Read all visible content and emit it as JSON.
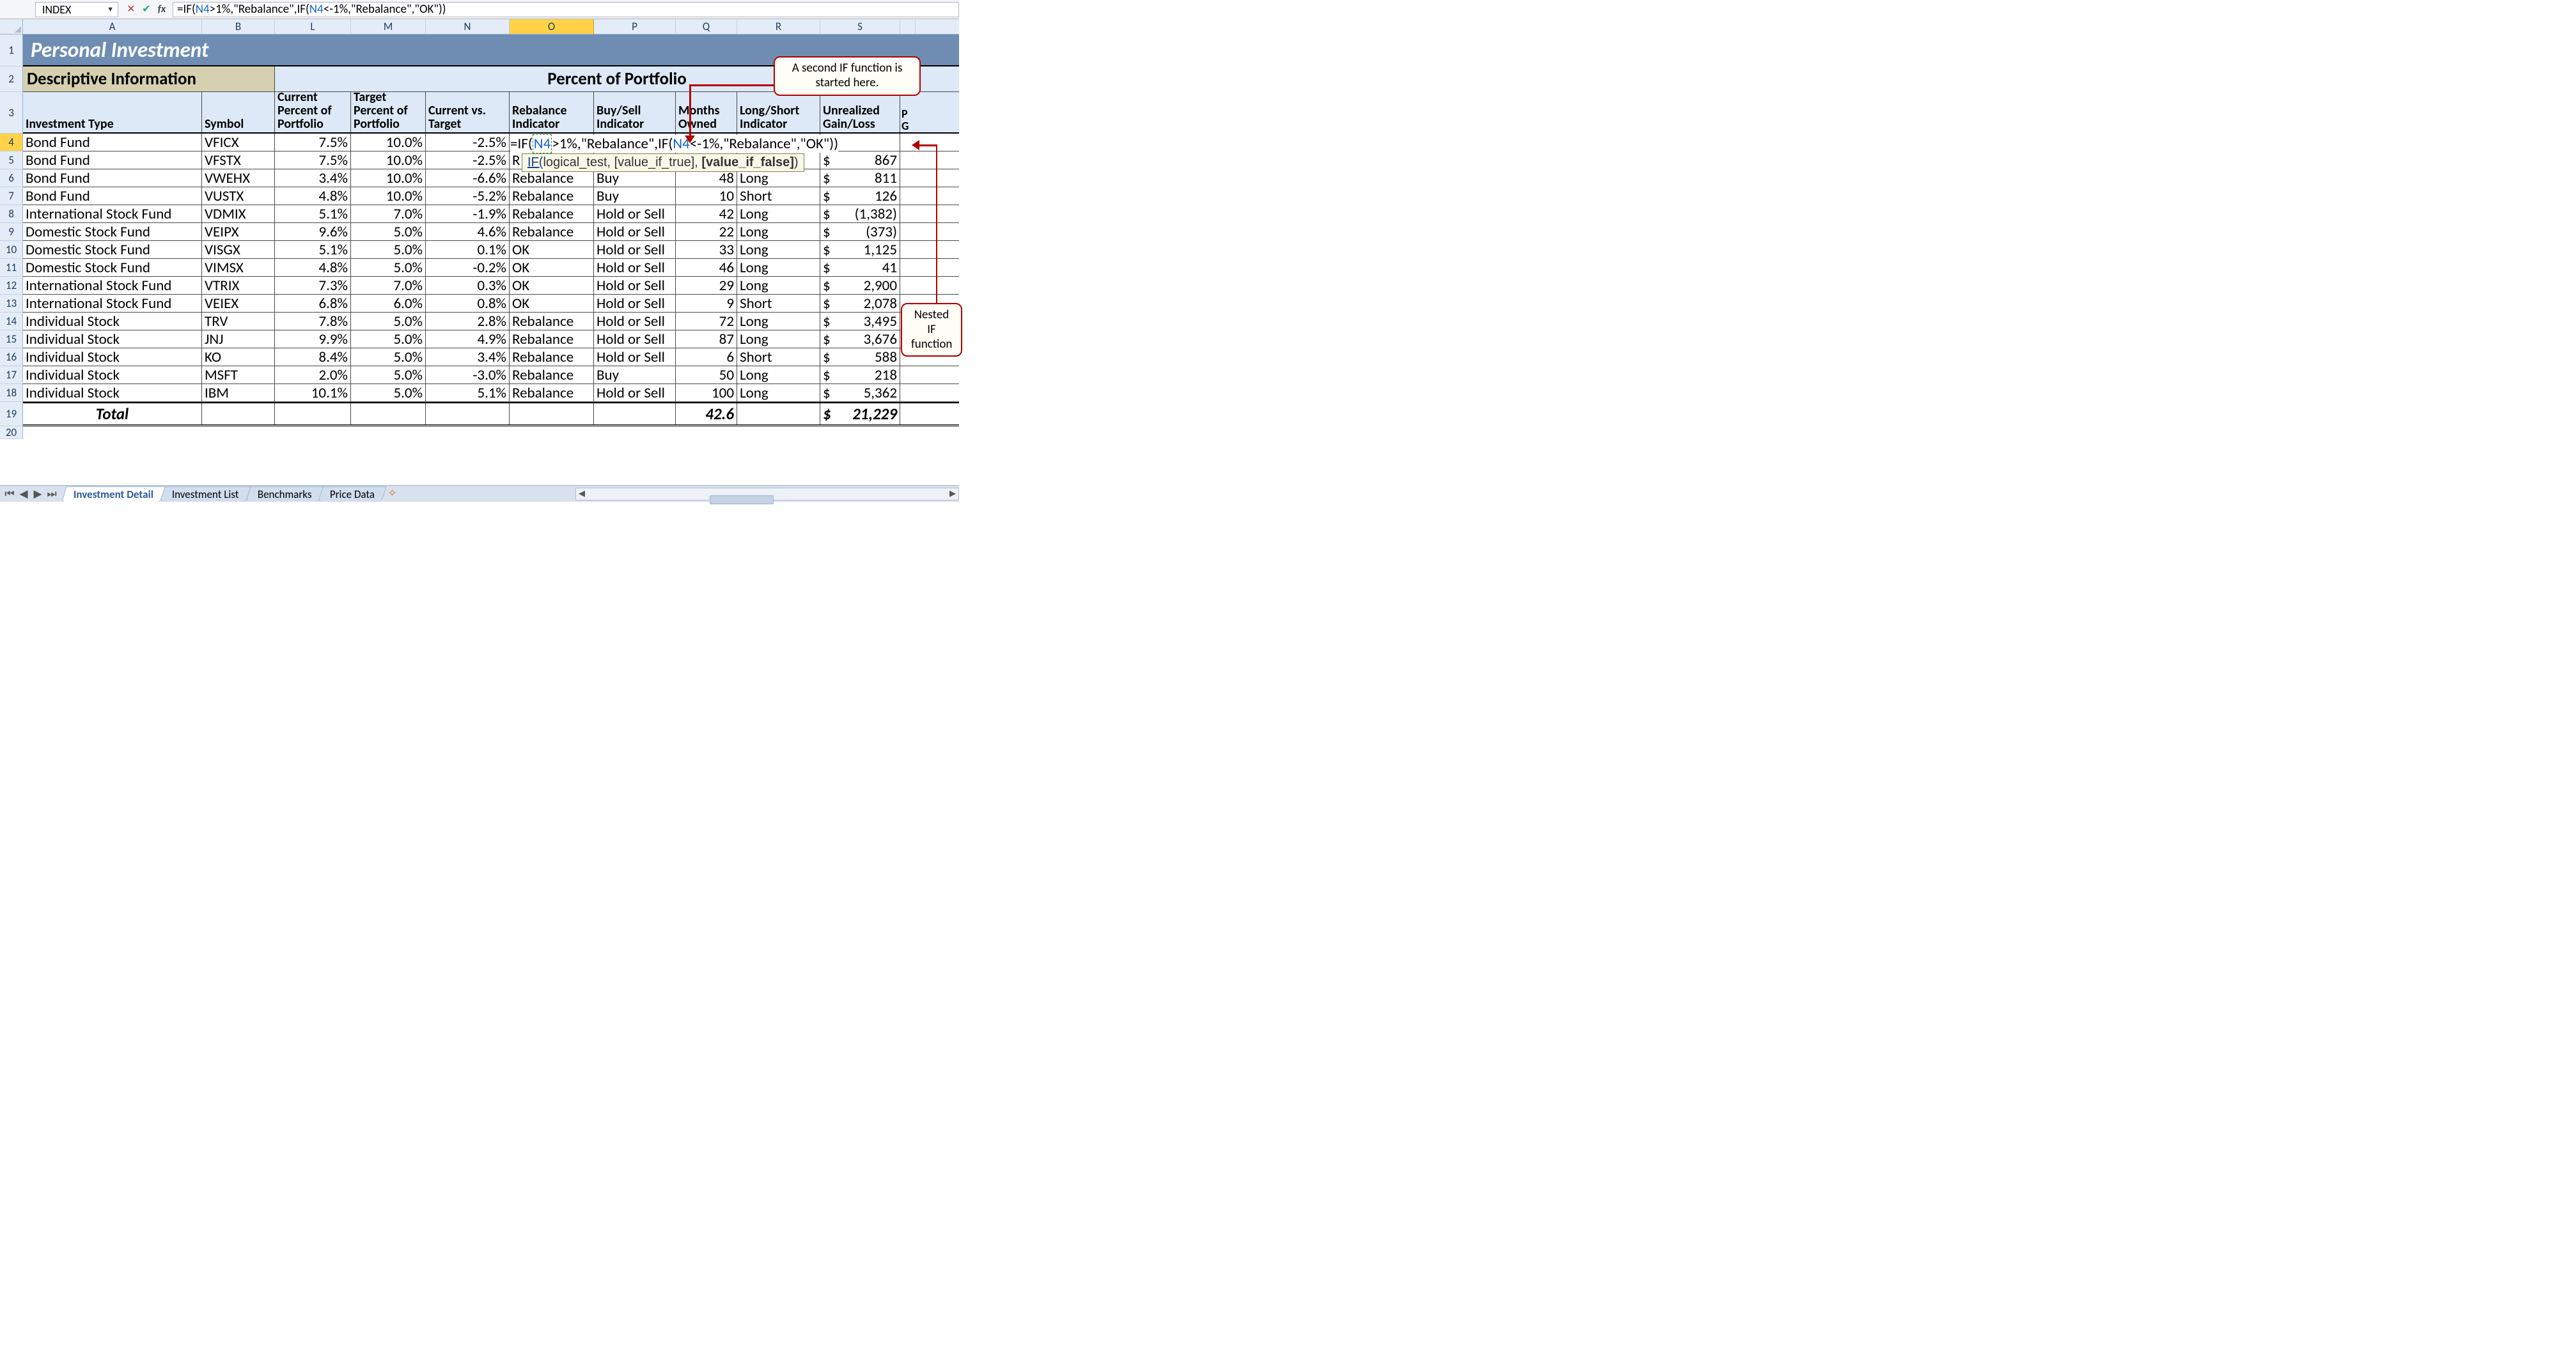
{
  "namebox": "INDEX",
  "formula_bar": "=IF(N4>1%,\"Rebalance\",IF(N4<-1%,\"Rebalance\",\"OK\"))",
  "title": "Personal Investment",
  "section_descriptive": "Descriptive Information",
  "section_pop": "Percent of Portfolio",
  "col_headers": {
    "A": "A",
    "B": "B",
    "L": "L",
    "M": "M",
    "N": "N",
    "O": "O",
    "P": "P",
    "Q": "Q",
    "R": "R",
    "S": "S"
  },
  "col_titles": {
    "A": "Investment Type",
    "B": "Symbol",
    "L": "Current Percent of Portfolio",
    "M": "Target Percent of Portfolio",
    "N": "Current vs. Target",
    "O": "Rebalance Indicator",
    "P": "Buy/Sell Indicator",
    "Q": "Months Owned",
    "R": "Long/Short Indicator",
    "S": "Unrealized Gain/Loss",
    "T": "Pe G"
  },
  "row_headers": [
    "1",
    "2",
    "3",
    "4",
    "5",
    "6",
    "7",
    "8",
    "9",
    "10",
    "11",
    "12",
    "13",
    "14",
    "15",
    "16",
    "17",
    "18",
    "19",
    "20"
  ],
  "data": [
    {
      "type": "Bond Fund",
      "sym": "VFICX",
      "cur": "7.5%",
      "tgt": "10.0%",
      "cvt": "-2.5%",
      "reb": "",
      "bs": "",
      "mo": "",
      "ls": "",
      "gain": ""
    },
    {
      "type": "Bond Fund",
      "sym": "VFSTX",
      "cur": "7.5%",
      "tgt": "10.0%",
      "cvt": "-2.5%",
      "reb": "R",
      "bs": "",
      "mo": "",
      "ls": "",
      "gain": "867"
    },
    {
      "type": "Bond Fund",
      "sym": "VWEHX",
      "cur": "3.4%",
      "tgt": "10.0%",
      "cvt": "-6.6%",
      "reb": "Rebalance",
      "bs": "Buy",
      "mo": "48",
      "ls": "Long",
      "gain": "811"
    },
    {
      "type": "Bond Fund",
      "sym": "VUSTX",
      "cur": "4.8%",
      "tgt": "10.0%",
      "cvt": "-5.2%",
      "reb": "Rebalance",
      "bs": "Buy",
      "mo": "10",
      "ls": "Short",
      "gain": "126"
    },
    {
      "type": "International Stock Fund",
      "sym": "VDMIX",
      "cur": "5.1%",
      "tgt": "7.0%",
      "cvt": "-1.9%",
      "reb": "Rebalance",
      "bs": "Hold or Sell",
      "mo": "42",
      "ls": "Long",
      "gain": "(1,382)"
    },
    {
      "type": "Domestic Stock Fund",
      "sym": "VEIPX",
      "cur": "9.6%",
      "tgt": "5.0%",
      "cvt": "4.6%",
      "reb": "Rebalance",
      "bs": "Hold or Sell",
      "mo": "22",
      "ls": "Long",
      "gain": "(373)"
    },
    {
      "type": "Domestic Stock Fund",
      "sym": "VISGX",
      "cur": "5.1%",
      "tgt": "5.0%",
      "cvt": "0.1%",
      "reb": "OK",
      "bs": "Hold or Sell",
      "mo": "33",
      "ls": "Long",
      "gain": "1,125"
    },
    {
      "type": "Domestic Stock Fund",
      "sym": "VIMSX",
      "cur": "4.8%",
      "tgt": "5.0%",
      "cvt": "-0.2%",
      "reb": "OK",
      "bs": "Hold or Sell",
      "mo": "46",
      "ls": "Long",
      "gain": "41"
    },
    {
      "type": "International Stock Fund",
      "sym": "VTRIX",
      "cur": "7.3%",
      "tgt": "7.0%",
      "cvt": "0.3%",
      "reb": "OK",
      "bs": "Hold or Sell",
      "mo": "29",
      "ls": "Long",
      "gain": "2,900"
    },
    {
      "type": "International Stock Fund",
      "sym": "VEIEX",
      "cur": "6.8%",
      "tgt": "6.0%",
      "cvt": "0.8%",
      "reb": "OK",
      "bs": "Hold or Sell",
      "mo": "9",
      "ls": "Short",
      "gain": "2,078"
    },
    {
      "type": "Individual Stock",
      "sym": "TRV",
      "cur": "7.8%",
      "tgt": "5.0%",
      "cvt": "2.8%",
      "reb": "Rebalance",
      "bs": "Hold or Sell",
      "mo": "72",
      "ls": "Long",
      "gain": "3,495"
    },
    {
      "type": "Individual Stock",
      "sym": "JNJ",
      "cur": "9.9%",
      "tgt": "5.0%",
      "cvt": "4.9%",
      "reb": "Rebalance",
      "bs": "Hold or Sell",
      "mo": "87",
      "ls": "Long",
      "gain": "3,676"
    },
    {
      "type": "Individual Stock",
      "sym": "KO",
      "cur": "8.4%",
      "tgt": "5.0%",
      "cvt": "3.4%",
      "reb": "Rebalance",
      "bs": "Hold or Sell",
      "mo": "6",
      "ls": "Short",
      "gain": "588"
    },
    {
      "type": "Individual Stock",
      "sym": "MSFT",
      "cur": "2.0%",
      "tgt": "5.0%",
      "cvt": "-3.0%",
      "reb": "Rebalance",
      "bs": "Buy",
      "mo": "50",
      "ls": "Long",
      "gain": "218"
    },
    {
      "type": "Individual Stock",
      "sym": "IBM",
      "cur": "10.1%",
      "tgt": "5.0%",
      "cvt": "5.1%",
      "reb": "Rebalance",
      "bs": "Hold or Sell",
      "mo": "100",
      "ls": "Long",
      "gain": "5,362"
    }
  ],
  "total": {
    "label": "Total",
    "mo": "42.6",
    "gain": "21,229"
  },
  "tabs": {
    "active": "Investment Detail",
    "others": [
      "Investment List",
      "Benchmarks",
      "Price Data"
    ]
  },
  "callouts": {
    "top": "A second IF function is started here.",
    "side": "Nested IF function"
  },
  "hint": {
    "pre": "IF(",
    "arg1": "logical_test",
    "arg2": "[value_if_true]",
    "arg3": "[value_if_false]",
    "post": ")"
  },
  "inline_formula": "=IF(N4>1%,\"Rebalance\",IF(N4<-1%,\"Rebalance\",\"OK\"))"
}
